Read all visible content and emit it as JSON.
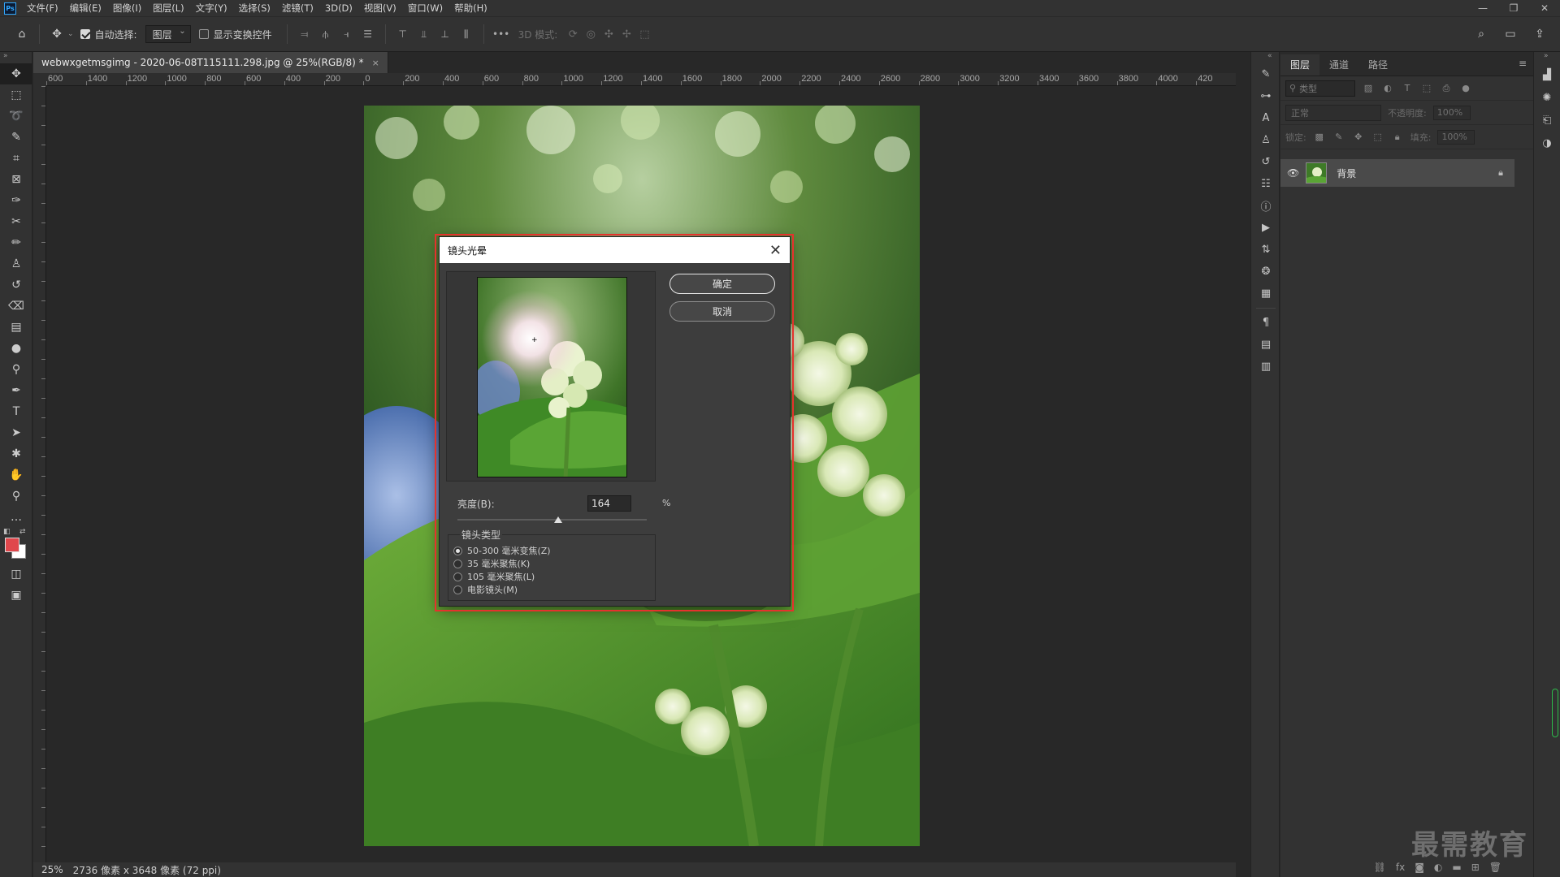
{
  "menubar": {
    "logo": "Ps",
    "items": [
      "文件(F)",
      "编辑(E)",
      "图像(I)",
      "图层(L)",
      "文字(Y)",
      "选择(S)",
      "滤镜(T)",
      "3D(D)",
      "视图(V)",
      "窗口(W)",
      "帮助(H)"
    ],
    "window_controls": {
      "minimize": "—",
      "restore": "❐",
      "close": "✕"
    }
  },
  "options": {
    "auto_select_label": "自动选择:",
    "auto_select_checked": true,
    "auto_select_target": "图层",
    "show_transform_label": "显示变换控件",
    "show_transform_checked": false,
    "more": "•••",
    "mode_label": "3D 模式:"
  },
  "document": {
    "tab_title": "webwxgetmsgimg - 2020-06-08T115111.298.jpg @ 25%(RGB/8) *",
    "tab_close": "×",
    "ruler_h_labels": [
      "600",
      "1400",
      "1200",
      "1000",
      "800",
      "600",
      "400",
      "200",
      "0",
      "200",
      "400",
      "600",
      "800",
      "1000",
      "1200",
      "1400",
      "1600",
      "1800",
      "2000",
      "2200",
      "2400",
      "2600",
      "2800",
      "3000",
      "3200",
      "3400",
      "3600",
      "3800",
      "4000",
      "420"
    ],
    "zoom": "25%",
    "size_info": "2736 像素 x 3648 像素 (72 ppi)"
  },
  "dialog": {
    "title": "镜头光晕",
    "close": "✕",
    "ok_label": "确定",
    "cancel_label": "取消",
    "brightness_label": "亮度(B):",
    "brightness_value": "164",
    "brightness_unit": "%",
    "brightness_percent": 164,
    "lens_group_label": "镜头类型",
    "lens_options": [
      {
        "label": "50-300 毫米变焦(Z)",
        "checked": true
      },
      {
        "label": "35 毫米聚焦(K)",
        "checked": false
      },
      {
        "label": "105 毫米聚焦(L)",
        "checked": false
      },
      {
        "label": "电影镜头(M)",
        "checked": false
      }
    ]
  },
  "layers_panel": {
    "tabs": [
      "图层",
      "通道",
      "路径"
    ],
    "active_tab": "图层",
    "filter_kind": "类型",
    "blend_mode": "正常",
    "opacity_label": "不透明度:",
    "opacity_value": "100%",
    "lock_label": "锁定:",
    "fill_label": "填充:",
    "fill_value": "100%",
    "layers": [
      {
        "name": "背景",
        "visible": true,
        "locked": true
      }
    ]
  },
  "watermark": "最需教育",
  "colors": {
    "foreground": "#e0474c",
    "background": "#ffffff",
    "highlight": "#e5322d"
  }
}
